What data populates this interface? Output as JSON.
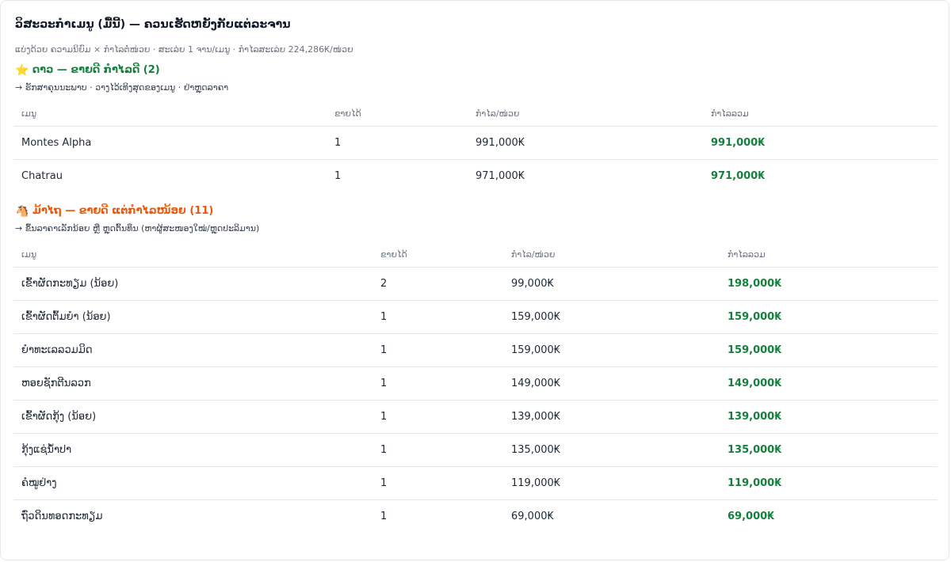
{
  "title": "ວິສະວະກຳເມນູ (ມື້ນີ້) — ຄວນເຮັດຫຍັງກັບແຕ່ລະຈານ",
  "subtitle": "ແບ່ງດ້ວຍ ຄວາມນິຍົມ × ກຳໄລຕໍ່ໜ່ວຍ · ສະເລ່ຍ 1 ຈານ/ເມນູ · ກຳໄລສະເລ່ຍ 224,286₭/ໜ່ວຍ",
  "stars": {
    "emoji": "⭐",
    "heading": "ດາວ — ຂາຍດີ ກຳໄລດີ (2)",
    "note": "→ ຮັກສາຄຸນນະພາບ · ວາງໄວ້ເທິງສຸດຂອງເມນູ · ຢ່າຫຼຸດລາຄາ",
    "columns": [
      "ເມນູ",
      "ຂາຍໄດ້",
      "ກຳໄລ/ໜ່ວຍ",
      "ກຳໄລລວມ"
    ],
    "rows": [
      {
        "name": "Montes Alpha",
        "sold": "1",
        "unit_profit": "991,000₭",
        "total": "991,000₭"
      },
      {
        "name": "Chatrau",
        "sold": "1",
        "unit_profit": "971,000₭",
        "total": "971,000₭"
      }
    ]
  },
  "plowhorses": {
    "emoji": "🐴",
    "heading": "ມ້າໄຖ — ຂາຍດີ ແຕ່ກຳໄລໜ້ອຍ (11)",
    "note": "→ ຂຶ້ນລາຄາເລັກນ້ອຍ ຫຼື ຫຼຸດຕົ້ນທຶນ (ຫາຜູ້ສະໜອງໃໝ່/ຫຼຸດປະລິມານ)",
    "columns": [
      "ເມນູ",
      "ຂາຍໄດ້",
      "ກຳໄລ/ໜ່ວຍ",
      "ກຳໄລລວມ"
    ],
    "rows": [
      {
        "name": "ເຂົ້າຜັດກະທຽມ (ນ້ອຍ)",
        "sold": "2",
        "unit_profit": "99,000₭",
        "total": "198,000₭"
      },
      {
        "name": "ເຂົ້າຜັດຕົ້ມຍຳ (ນ້ອຍ)",
        "sold": "1",
        "unit_profit": "159,000₭",
        "total": "159,000₭"
      },
      {
        "name": "ຍຳທະເລລວມມິດ",
        "sold": "1",
        "unit_profit": "159,000₭",
        "total": "159,000₭"
      },
      {
        "name": "ຫອຍຊັກຕີນລວກ",
        "sold": "1",
        "unit_profit": "149,000₭",
        "total": "149,000₭"
      },
      {
        "name": "ເຂົ້າຜັດກຸ້ງ (ນ້ອຍ)",
        "sold": "1",
        "unit_profit": "139,000₭",
        "total": "139,000₭"
      },
      {
        "name": "ກຸ້ງແຊ່ນ້ຳປາ",
        "sold": "1",
        "unit_profit": "135,000₭",
        "total": "135,000₭"
      },
      {
        "name": "ຄໍໝູຢ່າງ",
        "sold": "1",
        "unit_profit": "119,000₭",
        "total": "119,000₭"
      },
      {
        "name": "ຖົ່ວດິນທອດກະທຽມ",
        "sold": "1",
        "unit_profit": "69,000₭",
        "total": "69,000₭"
      }
    ]
  },
  "colors": {
    "stars_accent": "#15803d",
    "plowhorses_accent": "#ea580c",
    "total_value": "#15803d"
  }
}
